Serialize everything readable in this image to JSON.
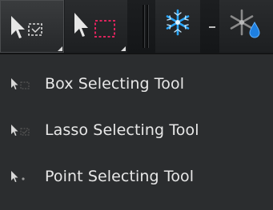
{
  "toolbar": {
    "buttons": [
      {
        "icon": "lasso-select-icon",
        "active": true
      },
      {
        "icon": "box-select-icon",
        "active": false
      },
      {
        "icon": "snowflake-icon",
        "active": false
      },
      {
        "icon": "freeze-drop-icon",
        "active": false
      }
    ]
  },
  "menu": {
    "items": [
      {
        "label": "Box Selecting Tool",
        "icon": "box-select-small-icon"
      },
      {
        "label": "Lasso Selecting Tool",
        "icon": "lasso-select-small-icon"
      },
      {
        "label": "Point Selecting Tool",
        "icon": "point-select-small-icon"
      }
    ]
  },
  "colors": {
    "accent_red": "#e0245e",
    "snowflake_blue": "#2aa8ff",
    "text": "#e8e8e8"
  }
}
